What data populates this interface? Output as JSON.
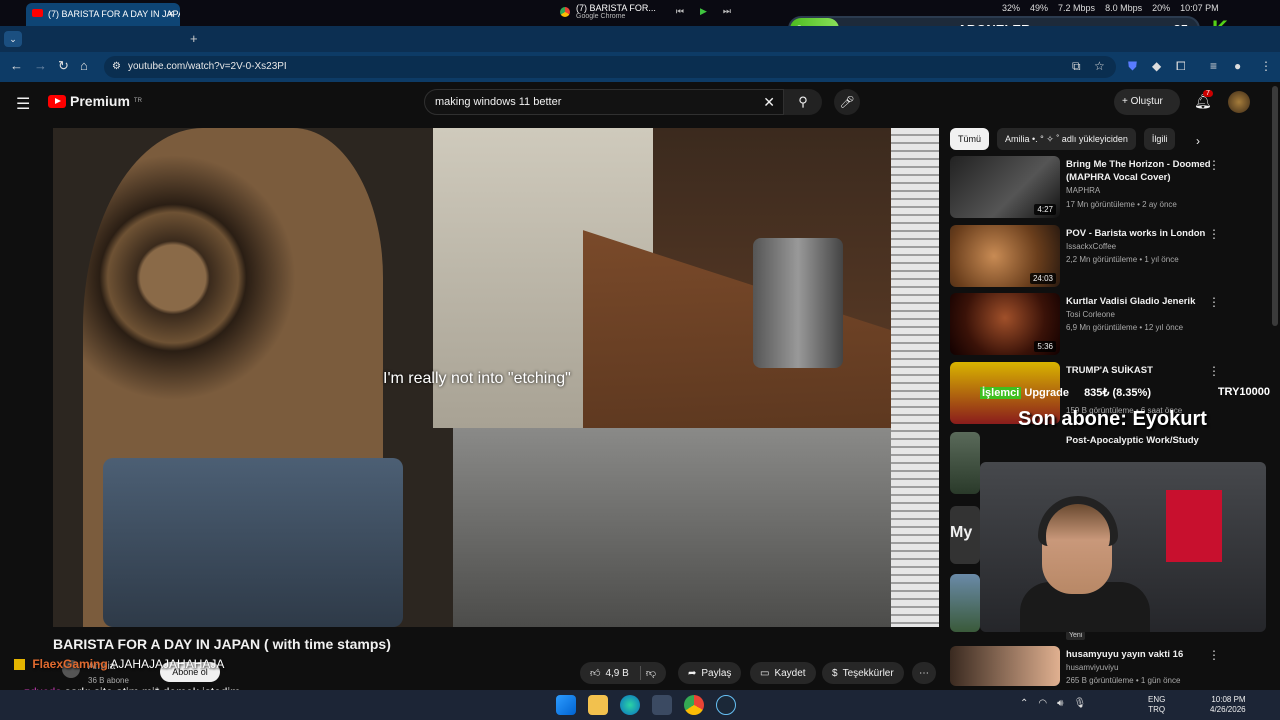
{
  "system_bar": {
    "media_title": "(7) BARISTA FOR...",
    "media_source": "Google Chrome",
    "cpu": "32%",
    "memory": "49%",
    "receive": "7.2 Mbps",
    "send": "8.0 Mbps",
    "extra": "20%",
    "clock": "10:07 PM",
    "date": "4/26/2026"
  },
  "sub_goal": {
    "left": "3",
    "title": "ABONELER",
    "right": "25",
    "progress_fraction": 0.12
  },
  "badge_letter": "K",
  "browser": {
    "tab_title": "(7) BARISTA FOR A DAY IN JAPAN",
    "new_tab": "+",
    "url": "youtube.com/watch?v=2V-0-Xs23PI"
  },
  "youtube": {
    "logo_text": "Premium",
    "region": "TR",
    "search_value": "making windows 11 better",
    "create_label": "Oluştur",
    "notif_count": "7"
  },
  "video": {
    "caption": "I'm really not into \"etching\"",
    "title": "BARISTA FOR A DAY IN JAPAN ( with time stamps)",
    "channel": "Amilia",
    "subs": "36 B abone",
    "subscribe_label": "Abone ol",
    "likes": "4,9 B",
    "share": "Paylaş",
    "save": "Kaydet",
    "thanks": "Teşekkürler"
  },
  "chat": [
    {
      "user": "FlaexGaming",
      "text": "AJAHAJAJAHAHAJA"
    },
    {
      "user": "zdxcds",
      "text": "sarkı site atim mi* demek istedim"
    }
  ],
  "chips": [
    "Tümü",
    "Amilia •. ° ✧ ˚ adlı yükleyiciden",
    "İlgili"
  ],
  "recommendations": [
    {
      "title": "Bring Me The Horizon - Doomed (MAPHRA Vocal Cover)",
      "channel": "MAPHRA",
      "meta": "17 Mn görüntüleme • 2 ay önce",
      "duration": "4:27"
    },
    {
      "title": "POV - Barista works in London",
      "channel": "IssackxCoffee",
      "meta": "2,2 Mn görüntüleme • 1 yıl önce",
      "duration": "24:03"
    },
    {
      "title": "Kurtlar Vadisi Gladio Jenerik",
      "channel": "Tosi Corleone",
      "meta": "6,9 Mn görüntüleme • 12 yıl önce",
      "duration": "5:36"
    },
    {
      "title": "TRUMP'A SUİKAST",
      "channel": "",
      "meta": "159 B görüntüleme • 6 saat önce",
      "duration": ""
    },
    {
      "title": "Post-Apocalyptic Work/Study",
      "channel": "",
      "meta": "",
      "duration": ""
    },
    {
      "title": "husamyuyu yayın vakti 16",
      "channel": "husamviyuviyu",
      "meta": "265 B görüntüleme • 1 gün önce",
      "duration": ""
    }
  ],
  "overlays": {
    "upgrade_tag": "İşlemci",
    "upgrade_text": "Upgrade",
    "upgrade_value": "835₺ (8.35%)",
    "upgrade_goal": "TRY10000",
    "last_sub_label": "Son abone: Eyokurt",
    "thumb_text": "My",
    "new_label": "Yeni"
  },
  "taskbar": {
    "lang_top": "ENG",
    "lang_bottom": "TRQ",
    "clock": "10:08 PM",
    "date": "4/26/2026"
  }
}
